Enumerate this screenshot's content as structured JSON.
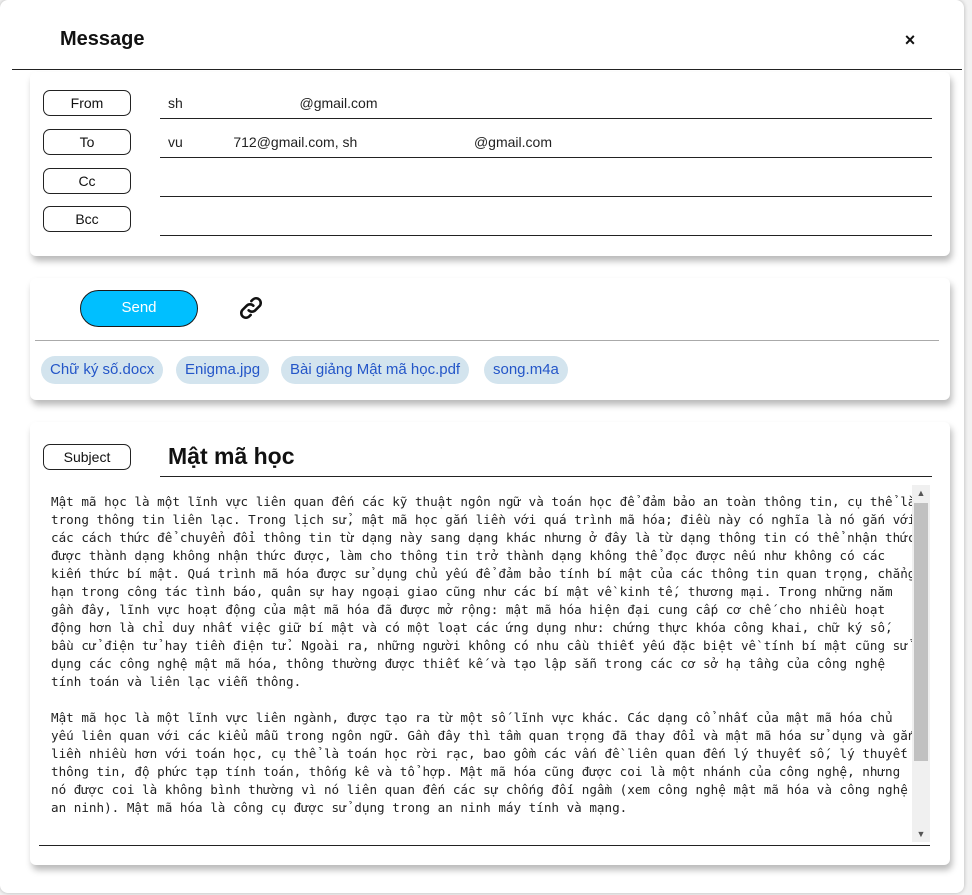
{
  "dialog": {
    "title": "Message",
    "close_label": "×"
  },
  "fields": {
    "from": {
      "label": "From",
      "value": "sh                              @gmail.com"
    },
    "to": {
      "label": "To",
      "value": "vu             712@gmail.com, sh                              @gmail.com"
    },
    "cc": {
      "label": "Cc",
      "value": ""
    },
    "bcc": {
      "label": "Bcc",
      "value": ""
    }
  },
  "toolbar": {
    "send_label": "Send",
    "link_icon": "link-icon"
  },
  "attachments": [
    "Chữ ký số.docx",
    "Enigma.jpg",
    "Bài giảng Mật mã học.pdf",
    "song.m4a"
  ],
  "subject": {
    "label": "Subject",
    "value": "Mật mã học"
  },
  "body": "Mật mã học là một lĩnh vực liên quan đến các kỹ thuật ngôn ngữ và toán học để đảm bảo an toàn thông tin, cụ thể là trong thông tin liên lạc. Trong lịch sử, mật mã học gắn liền với quá trình mã hóa; điều này có nghĩa là nó gắn với các cách thức để chuyển đổi thông tin từ dạng này sang dạng khác nhưng ở đây là từ dạng thông tin có thể nhận thức được thành dạng không nhận thức được, làm cho thông tin trở thành dạng không thể đọc được nếu như không có các kiến thức bí mật. Quá trình mã hóa được sử dụng chủ yếu để đảm bảo tính bí mật của các thông tin quan trọng, chẳng hạn trong công tác tình báo, quân sự hay ngoại giao cũng như các bí mật về kinh tế, thương mại. Trong những năm gần đây, lĩnh vực hoạt động của mật mã hóa đã được mở rộng: mật mã hóa hiện đại cung cấp cơ chế cho nhiều hoạt động hơn là chỉ duy nhất việc giữ bí mật và có một loạt các ứng dụng như: chứng thực khóa công khai, chữ ký số, bầu cử điện tử hay tiền điện tử. Ngoài ra, những người không có nhu cầu thiết yếu đặc biệt về tính bí mật cũng sử dụng các công nghệ mật mã hóa, thông thường được thiết kế và tạo lập sẵn trong các cơ sở hạ tầng của công nghệ tính toán và liên lạc viễn thông.\n\nMật mã học là một lĩnh vực liên ngành, được tạo ra từ một số lĩnh vực khác. Các dạng cổ nhất của mật mã hóa chủ yếu liên quan với các kiểu mẫu trong ngôn ngữ. Gần đây thì tầm quan trọng đã thay đổi và mật mã hóa sử dụng và gắn liền nhiều hơn với toán học, cụ thể là toán học rời rạc, bao gồm các vấn đề liên quan đến lý thuyết số, lý thuyết thông tin, độ phức tạp tính toán, thống kê và tổ hợp. Mật mã hóa cũng được coi là một nhánh của công nghệ, nhưng nó được coi là không bình thường vì nó liên quan đến các sự chống đối ngầm (xem công nghệ mật mã hóa và công nghệ an ninh). Mật mã hóa là công cụ được sử dụng trong an ninh máy tính và mạng."
}
